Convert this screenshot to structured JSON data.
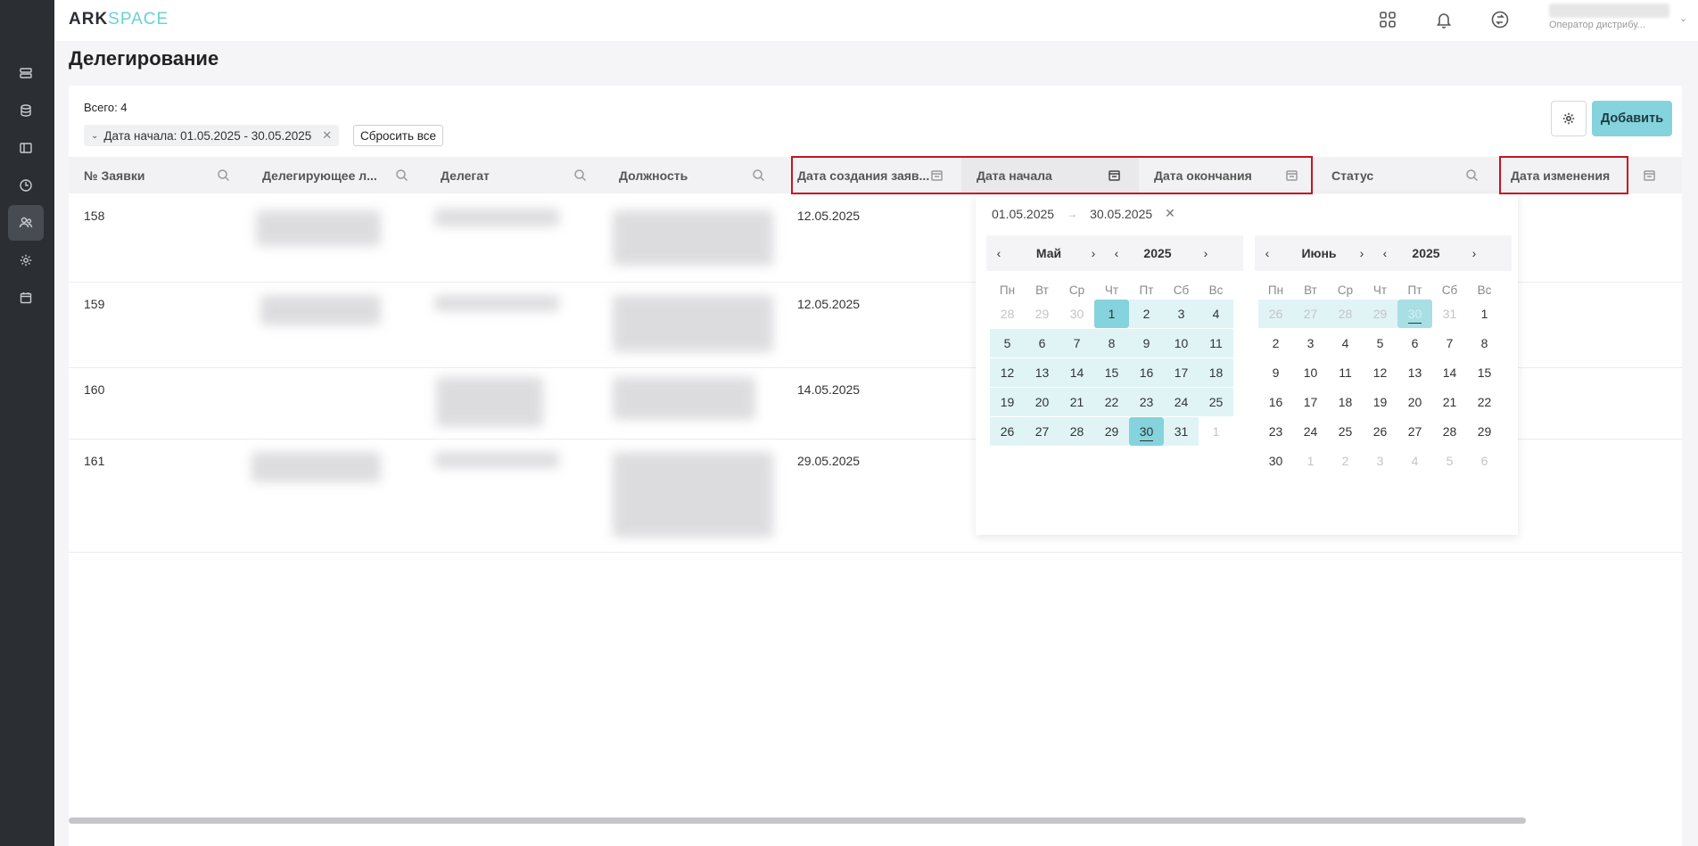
{
  "app": {
    "logo_part1": "ARK",
    "logo_part2": "SPACE"
  },
  "sidebar": {
    "items": [
      {
        "name": "sidebar-item-requests",
        "icon": "list-icon"
      },
      {
        "name": "sidebar-item-database",
        "icon": "database-icon"
      },
      {
        "name": "sidebar-item-layout",
        "icon": "layout-icon"
      },
      {
        "name": "sidebar-item-history",
        "icon": "clock-icon"
      },
      {
        "name": "sidebar-item-delegation",
        "icon": "users-icon",
        "active": true
      },
      {
        "name": "sidebar-item-settings",
        "icon": "gear-icon"
      },
      {
        "name": "sidebar-item-calendar",
        "icon": "calendar-icon"
      }
    ]
  },
  "header": {
    "user_role": "Оператор дистрибу...",
    "icons": [
      "apps-icon",
      "bell-icon",
      "exchange-icon"
    ]
  },
  "page": {
    "title": "Делегирование"
  },
  "toolbar": {
    "total_label": "Всего: 4",
    "filter_chip": "Дата начала: 01.05.2025 - 30.05.2025",
    "reset_label": "Сбросить все",
    "add_label": "Добавить"
  },
  "table": {
    "columns": [
      "№ Заявки",
      "Делегирующее л...",
      "Делегат",
      "Должность",
      "Дата создания заяв...",
      "Дата начала",
      "Дата окончания",
      "Статус",
      "Дата изменения"
    ],
    "rows": [
      {
        "id": "158",
        "created": "12.05.2025"
      },
      {
        "id": "159",
        "created": "12.05.2025"
      },
      {
        "id": "160",
        "created": "14.05.2025"
      },
      {
        "id": "161",
        "created": "29.05.2025"
      }
    ]
  },
  "datepicker": {
    "from": "01.05.2025",
    "to": "30.05.2025",
    "weekdays": [
      "Пн",
      "Вт",
      "Ср",
      "Чт",
      "Пт",
      "Сб",
      "Вс"
    ],
    "left": {
      "month": "Май",
      "year": "2025",
      "weeks": [
        [
          "28",
          "29",
          "30",
          "1",
          "2",
          "3",
          "4"
        ],
        [
          "5",
          "6",
          "7",
          "8",
          "9",
          "10",
          "11"
        ],
        [
          "12",
          "13",
          "14",
          "15",
          "16",
          "17",
          "18"
        ],
        [
          "19",
          "20",
          "21",
          "22",
          "23",
          "24",
          "25"
        ],
        [
          "26",
          "27",
          "28",
          "29",
          "30",
          "31",
          "1"
        ]
      ]
    },
    "right": {
      "month": "Июнь",
      "year": "2025",
      "weeks": [
        [
          "26",
          "27",
          "28",
          "29",
          "30",
          "31",
          "1"
        ],
        [
          "2",
          "3",
          "4",
          "5",
          "6",
          "7",
          "8"
        ],
        [
          "9",
          "10",
          "11",
          "12",
          "13",
          "14",
          "15"
        ],
        [
          "16",
          "17",
          "18",
          "19",
          "20",
          "21",
          "22"
        ],
        [
          "23",
          "24",
          "25",
          "26",
          "27",
          "28",
          "29"
        ],
        [
          "30",
          "1",
          "2",
          "3",
          "4",
          "5",
          "6"
        ]
      ]
    },
    "colors": {
      "selected": "#85d3dc",
      "range": "#e0f4f6",
      "highlight_border": "#c8141c"
    }
  }
}
